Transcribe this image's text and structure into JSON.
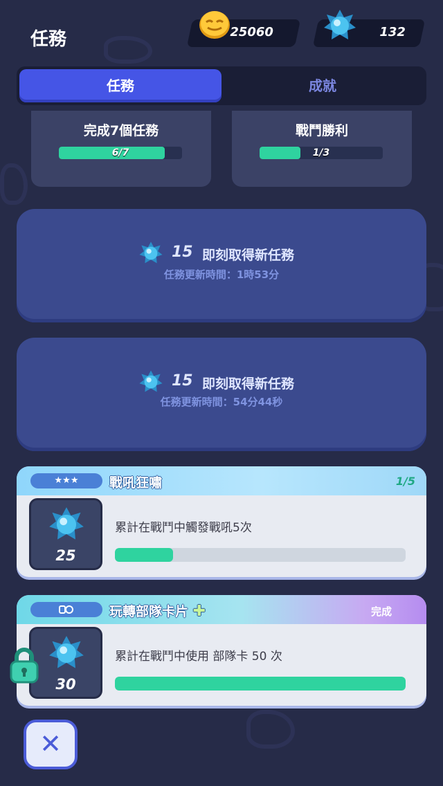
{
  "header": {
    "title": "任務",
    "coins": "25060",
    "gems": "132"
  },
  "tabs": [
    {
      "label": "任務",
      "active": true
    },
    {
      "label": "成就",
      "active": false
    }
  ],
  "objectives": [
    {
      "title": "完成7個任務",
      "progress_text": "6/7",
      "progress": 0.857
    },
    {
      "title": "戰鬥勝利",
      "progress_text": "1/3",
      "progress": 0.333
    }
  ],
  "refresh_slots": [
    {
      "cost": "15",
      "label": "即刻取得新任務",
      "timer": "任務更新時間：1時53分"
    },
    {
      "cost": "15",
      "label": "即刻取得新任務",
      "timer": "任務更新時間：54分44秒"
    }
  ],
  "quests": [
    {
      "title": "戰吼狂嘯",
      "pill": "★★★",
      "progress_text": "1/5",
      "reward": "25",
      "description": "累計在戰鬥中觸發戰吼5次",
      "progress": 0.2
    },
    {
      "title": "玩轉部隊卡片",
      "pill": "",
      "status": "完成",
      "reward": "30",
      "description": "累計在戰鬥中使用 部隊卡 50 次",
      "progress": 1.0
    }
  ],
  "close_label": "✕",
  "colors": {
    "background": "#262b48",
    "accent": "#4555e6",
    "progress": "#2fd39f"
  }
}
